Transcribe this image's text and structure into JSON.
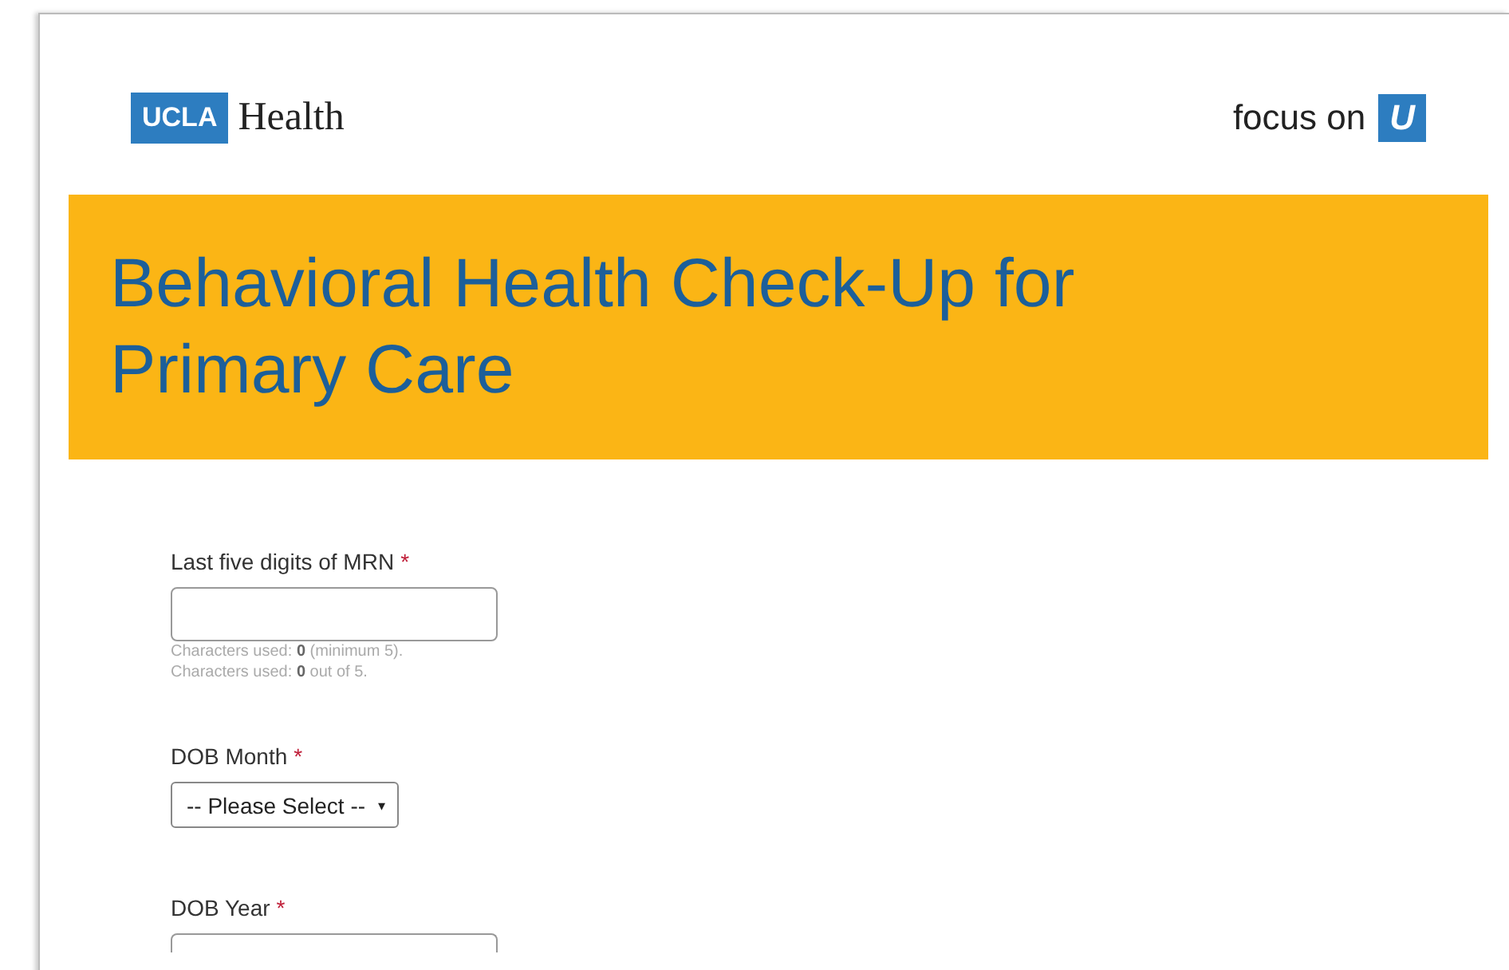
{
  "header": {
    "logo_badge": "UCLA",
    "logo_text": "Health",
    "tagline": "focus on",
    "tagline_badge": "U"
  },
  "banner": {
    "title": "Behavioral Health Check-Up for Primary Care"
  },
  "fields": [
    {
      "kind": "text",
      "label": "Last five digits of MRN",
      "required_mark": "*",
      "hints": [
        "Characters used: **0** (minimum 5).",
        "Characters used: **0** out of 5."
      ]
    },
    {
      "kind": "select",
      "label": "DOB Month",
      "required_mark": "*",
      "value": "-- Please Select --",
      "arrow": "▾"
    },
    {
      "kind": "partial",
      "label": "DOB Year",
      "required_mark": "*"
    }
  ]
}
